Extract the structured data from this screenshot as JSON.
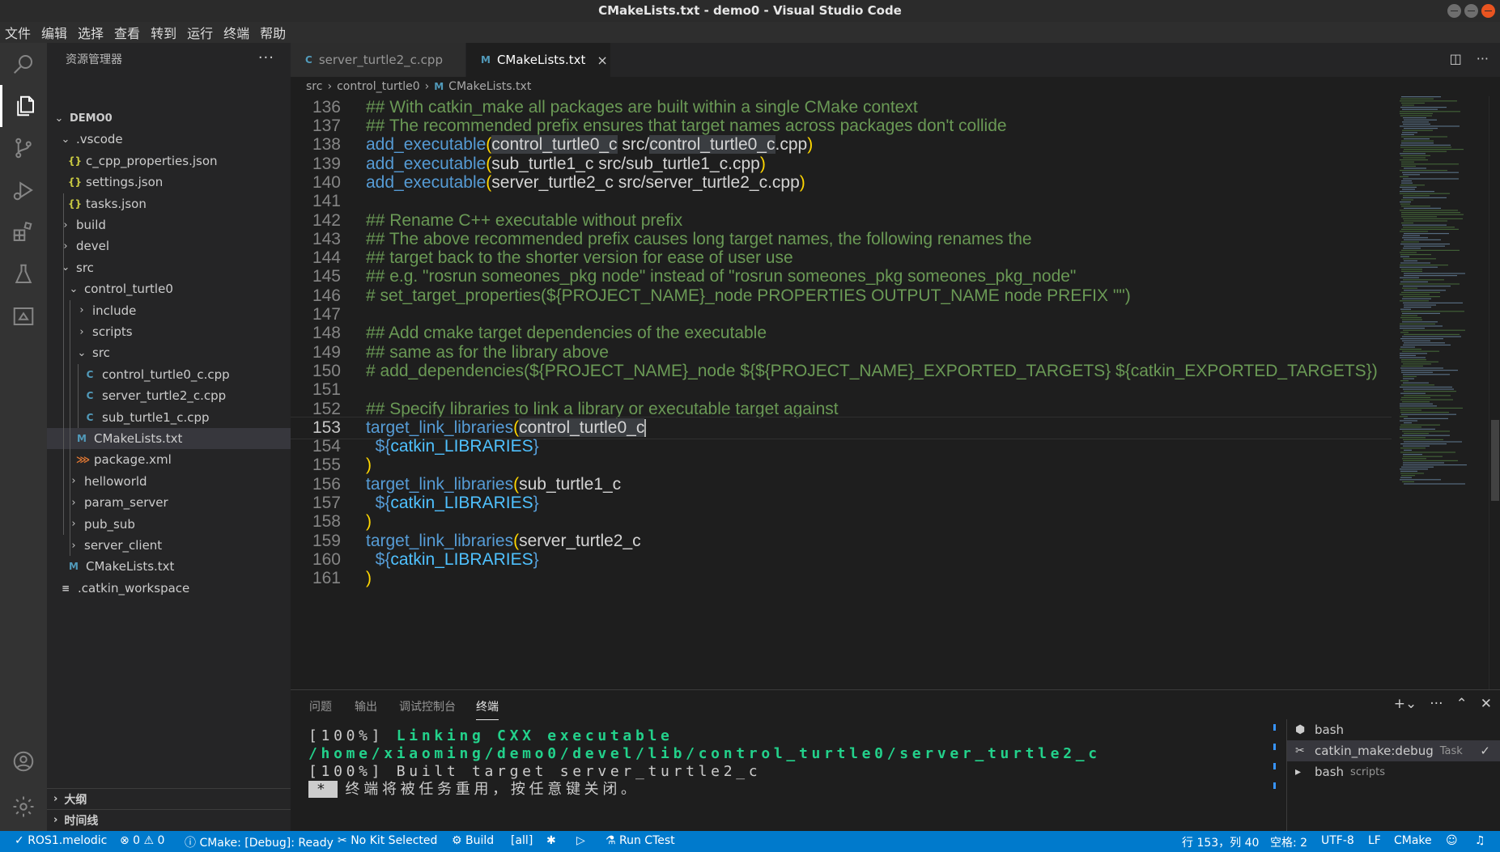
{
  "window": {
    "title": "CMakeLists.txt - demo0 - Visual Studio Code"
  },
  "menu": [
    "文件",
    "编辑",
    "选择",
    "查看",
    "转到",
    "运行",
    "终端",
    "帮助"
  ],
  "activity": [
    "search-icon",
    "files-icon",
    "source-control-icon",
    "run-debug-icon",
    "extensions-icon",
    "testing-icon",
    "remote-explorer-icon",
    "account-icon",
    "settings-gear-icon"
  ],
  "sidebar": {
    "title": "资源管理器",
    "more": "···",
    "tree": [
      {
        "label": "DEMO0",
        "kind": "root",
        "depth": 0,
        "open": true
      },
      {
        "label": ".vscode",
        "kind": "folder",
        "depth": 1,
        "open": true
      },
      {
        "label": "c_cpp_properties.json",
        "kind": "json",
        "depth": 2
      },
      {
        "label": "settings.json",
        "kind": "json",
        "depth": 2
      },
      {
        "label": "tasks.json",
        "kind": "json",
        "depth": 2
      },
      {
        "label": "build",
        "kind": "folder",
        "depth": 1,
        "open": false
      },
      {
        "label": "devel",
        "kind": "folder",
        "depth": 1,
        "open": false
      },
      {
        "label": "src",
        "kind": "folder",
        "depth": 1,
        "open": true
      },
      {
        "label": "control_turtle0",
        "kind": "folder",
        "depth": 2,
        "open": true
      },
      {
        "label": "include",
        "kind": "folder",
        "depth": 3,
        "open": false
      },
      {
        "label": "scripts",
        "kind": "folder",
        "depth": 3,
        "open": false
      },
      {
        "label": "src",
        "kind": "folder",
        "depth": 3,
        "open": true
      },
      {
        "label": "control_turtle0_c.cpp",
        "kind": "cpp",
        "depth": 4
      },
      {
        "label": "server_turtle2_c.cpp",
        "kind": "cpp",
        "depth": 4
      },
      {
        "label": "sub_turtle1_c.cpp",
        "kind": "cpp",
        "depth": 4
      },
      {
        "label": "CMakeLists.txt",
        "kind": "cmake",
        "depth": 3,
        "selected": true
      },
      {
        "label": "package.xml",
        "kind": "xml",
        "depth": 3
      },
      {
        "label": "helloworld",
        "kind": "folder",
        "depth": 2,
        "open": false
      },
      {
        "label": "param_server",
        "kind": "folder",
        "depth": 2,
        "open": false
      },
      {
        "label": "pub_sub",
        "kind": "folder",
        "depth": 2,
        "open": false
      },
      {
        "label": "server_client",
        "kind": "folder",
        "depth": 2,
        "open": false
      },
      {
        "label": "CMakeLists.txt",
        "kind": "cmake",
        "depth": 2
      },
      {
        "label": ".catkin_workspace",
        "kind": "plain",
        "depth": 1
      }
    ],
    "sections": [
      "大纲",
      "时间线"
    ]
  },
  "tabs": [
    {
      "label": "server_turtle2_c.cpp",
      "icon": "C",
      "active": false
    },
    {
      "label": "CMakeLists.txt",
      "icon": "M",
      "active": true,
      "close": "×"
    }
  ],
  "breadcrumb": [
    "src",
    "control_turtle0",
    "CMakeLists.txt"
  ],
  "editor": {
    "lines": [
      {
        "n": "136",
        "code": "## With catkin_make all packages are built within a single CMake context"
      },
      {
        "n": "137",
        "code": "## The recommended prefix ensures that target names across packages don't collide"
      },
      {
        "n": "138",
        "code": "add_executable(control_turtle0_c src/control_turtle0_c.cpp)"
      },
      {
        "n": "139",
        "code": "add_executable(sub_turtle1_c src/sub_turtle1_c.cpp)"
      },
      {
        "n": "140",
        "code": "add_executable(server_turtle2_c src/server_turtle2_c.cpp)"
      },
      {
        "n": "141",
        "code": ""
      },
      {
        "n": "142",
        "code": "## Rename C++ executable without prefix"
      },
      {
        "n": "143",
        "code": "## The above recommended prefix causes long target names, the following renames the"
      },
      {
        "n": "144",
        "code": "## target back to the shorter version for ease of user use"
      },
      {
        "n": "145",
        "code": "## e.g. \"rosrun someones_pkg node\" instead of \"rosrun someones_pkg someones_pkg_node\""
      },
      {
        "n": "146",
        "code": "# set_target_properties(${PROJECT_NAME}_node PROPERTIES OUTPUT_NAME node PREFIX \"\")"
      },
      {
        "n": "147",
        "code": ""
      },
      {
        "n": "148",
        "code": "## Add cmake target dependencies of the executable"
      },
      {
        "n": "149",
        "code": "## same as for the library above"
      },
      {
        "n": "150",
        "code": "# add_dependencies(${PROJECT_NAME}_node ${${PROJECT_NAME}_EXPORTED_TARGETS} ${catkin_EXPORTED_TARGETS})"
      },
      {
        "n": "151",
        "code": ""
      },
      {
        "n": "152",
        "code": "## Specify libraries to link a library or executable target against"
      },
      {
        "n": "153",
        "code": "target_link_libraries(control_turtle0_c"
      },
      {
        "n": "154",
        "code": "  ${catkin_LIBRARIES}"
      },
      {
        "n": "155",
        "code": ")"
      },
      {
        "n": "156",
        "code": "target_link_libraries(sub_turtle1_c"
      },
      {
        "n": "157",
        "code": "  ${catkin_LIBRARIES}"
      },
      {
        "n": "158",
        "code": ")"
      },
      {
        "n": "159",
        "code": "target_link_libraries(server_turtle2_c"
      },
      {
        "n": "160",
        "code": "  ${catkin_LIBRARIES}"
      },
      {
        "n": "161",
        "code": ")"
      }
    ],
    "current_line": "153"
  },
  "panel": {
    "tabs": [
      "问题",
      "输出",
      "调试控制台",
      "终端"
    ],
    "active_tab": "终端",
    "terminal": {
      "line1_prefix": "[100%] ",
      "line1_green": "Linking CXX executable /home/xiaoming/demo0/devel/lib/control_turtle0/server_turtle2_c",
      "line2": "[100%] Built target server_turtle2_c",
      "line3_block": "*",
      "line3": "终端将被任务重用，按任意键关闭。"
    },
    "terminals": [
      {
        "label": "bash",
        "sub": "",
        "icon": "bash-icon"
      },
      {
        "label": "catkin_make:debug",
        "sub": "Task",
        "icon": "tools-icon",
        "selected": true,
        "check": "✓"
      },
      {
        "label": "bash",
        "sub": "scripts",
        "icon": "terminal-icon"
      }
    ]
  },
  "status": {
    "ros": "ROS1.melodic",
    "problems": "⊗ 0 ⚠ 0",
    "cmake": "CMake: [Debug]: Ready",
    "kit": "No Kit Selected",
    "build": "Build",
    "all": "[all]",
    "ctest": "Run CTest",
    "position": "行 153，列 40",
    "spaces": "空格: 2",
    "encoding": "UTF-8",
    "eol": "LF",
    "language": "CMake"
  },
  "colors": {
    "accent": "#007acc",
    "comment": "#6a9955",
    "keyword": "#569cd6",
    "variable": "#4fc1ff",
    "bracket": "#ffd700",
    "terminal_green": "#23d18b"
  }
}
